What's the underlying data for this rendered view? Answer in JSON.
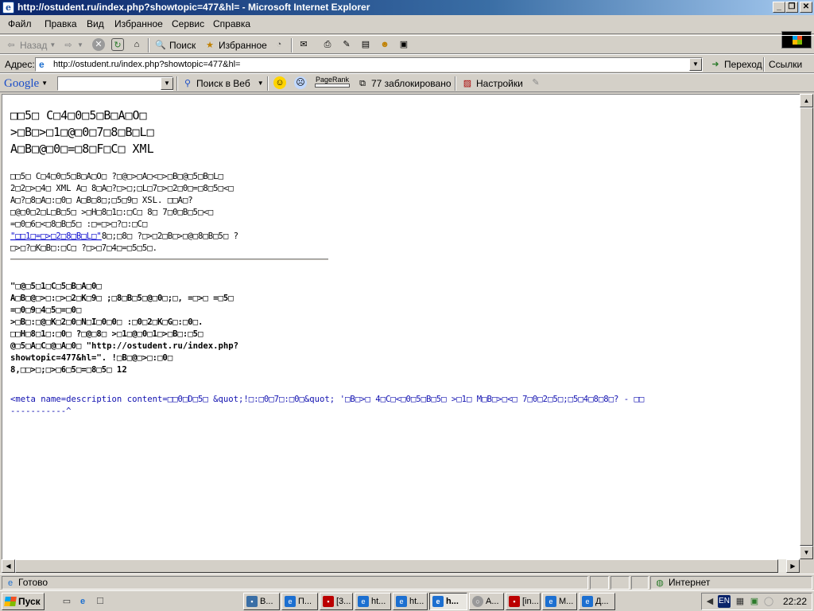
{
  "window": {
    "title": "http://ostudent.ru/index.php?showtopic=477&hl= - Microsoft Internet Explorer",
    "minimize": "_",
    "maximize": "❐",
    "close": "✕"
  },
  "menu": [
    "Файл",
    "Правка",
    "Вид",
    "Избранное",
    "Сервис",
    "Справка"
  ],
  "toolbar": {
    "back": "Назад",
    "search": "Поиск",
    "favorites": "Избранное"
  },
  "address": {
    "label": "Адрес:",
    "value": "http://ostudent.ru/index.php?showtopic=477&hl=",
    "go": "Переход",
    "links": "Ссылки"
  },
  "google": {
    "logo": "Google",
    "search_web": "Поиск в Веб",
    "pagerank": "PageRank",
    "blocked": "77 заблокировано",
    "settings": "Настройки"
  },
  "page": {
    "heading": [
      "□□5□ C□4□0□5□B□A□O□",
      ">□B□>□1□@□0□7□8□B□L□",
      "A□B□@□0□=□8□F□C□ XML"
    ],
    "para": [
      "□□5□ C□4□0□5□B□A□O□ ?□@□>□A□<□>□B□@□5□B□L□",
      "2□2□>□4□ XML A□ 8□A□?□>□;□L□7□>□2□0□=□8□5□<□",
      "A□?□8□A□:□0□ A□B□8□;□5□9□ XSL. □□A□?",
      "□@□0□2□L□B□5□ >□H□8□1□:□C□ 8□ 7□0□B□5□<□",
      "=□0□6□<□8□B□5□ :□=□>□?□:□C□"
    ],
    "link_text": "\"□□1□=□>□2□8□B□L□\"",
    "para_tail": "8□;□8□ ?□>□2□B□>□@□8□B□5□ ?",
    "para_last": "□>□?□K□B□:□C□ ?□>□7□4□=□5□5□.",
    "bold": [
      "\"□@□5□1□C□5□B□A□0□",
      "A□B□@□>□:□>□2□K□9□ ;□8□B□5□@□0□;□, =□>□ =□5□",
      "=□0□9□4□5□=□0□",
      ">□B□:□@□K□2□0□N□I□0□0□ :□0□2□K□G□:□0□.",
      "□□H□8□1□:□0□ ?□@□8□ >□1□@□0□1□>□B□:□5□",
      "@□5□A□C□@□A□0□ \"http://ostudent.ru/index.php?",
      "showtopic=477&hl=\". !□B□@□>□:□0□",
      "8,□□>□;□>□6□5□=□8□5□ 12"
    ],
    "error_line": "<meta name=description content=□□0□D□5□ &quot;!□:□0□7□:□0□&quot; '□B□>□ 4□C□<□0□5□B□5□ >□1□ M□B□>□<□ 7□0□2□5□;□5□4□8□8□? - □□",
    "error_marker": "-----------^"
  },
  "status": {
    "text": "Готово",
    "zone": "Интернет"
  },
  "taskbar": {
    "start": "Пуск",
    "clock": "22:22",
    "lang": "EN",
    "buttons": [
      "В...",
      "П...",
      "[3...",
      "ht...",
      "ht...",
      "h...",
      "А...",
      "[in...",
      "М...",
      "Д..."
    ]
  }
}
